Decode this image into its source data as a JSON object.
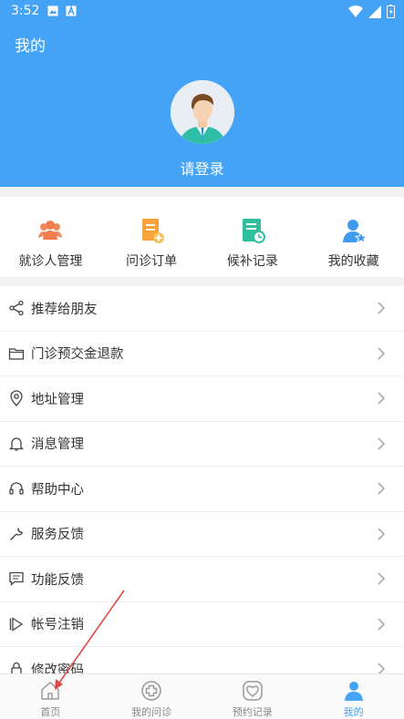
{
  "status_bar": {
    "time": "3:52"
  },
  "header": {
    "title": "我的",
    "login": "请登录"
  },
  "quick_actions": [
    {
      "label": "就诊人管理",
      "icon": "patients-icon"
    },
    {
      "label": "问诊订单",
      "icon": "order-icon"
    },
    {
      "label": "候补记录",
      "icon": "waitlist-icon"
    },
    {
      "label": "我的收藏",
      "icon": "favorites-icon"
    }
  ],
  "menu": [
    {
      "label": "推荐给朋友",
      "icon": "share-icon"
    },
    {
      "label": "门诊预交金退款",
      "icon": "folder-icon"
    },
    {
      "label": "地址管理",
      "icon": "location-icon"
    },
    {
      "label": "消息管理",
      "icon": "bell-icon"
    },
    {
      "label": "帮助中心",
      "icon": "headset-icon"
    },
    {
      "label": "服务反馈",
      "icon": "wrench-icon"
    },
    {
      "label": "功能反馈",
      "icon": "comment-icon"
    },
    {
      "label": "帐号注销",
      "icon": "play-bar-icon"
    },
    {
      "label": "修改密码",
      "icon": "lock-icon"
    }
  ],
  "tabbar": [
    {
      "label": "首页",
      "icon": "home-icon",
      "active": false
    },
    {
      "label": "我的问诊",
      "icon": "consult-icon",
      "active": false
    },
    {
      "label": "预约记录",
      "icon": "heart-icon",
      "active": false
    },
    {
      "label": "我的",
      "icon": "person-icon",
      "active": true
    }
  ],
  "colors": {
    "brand": "#45a3f5",
    "orange": "#f5a33a",
    "teal": "#2fbf9f",
    "red_arrow": "#e04848"
  }
}
